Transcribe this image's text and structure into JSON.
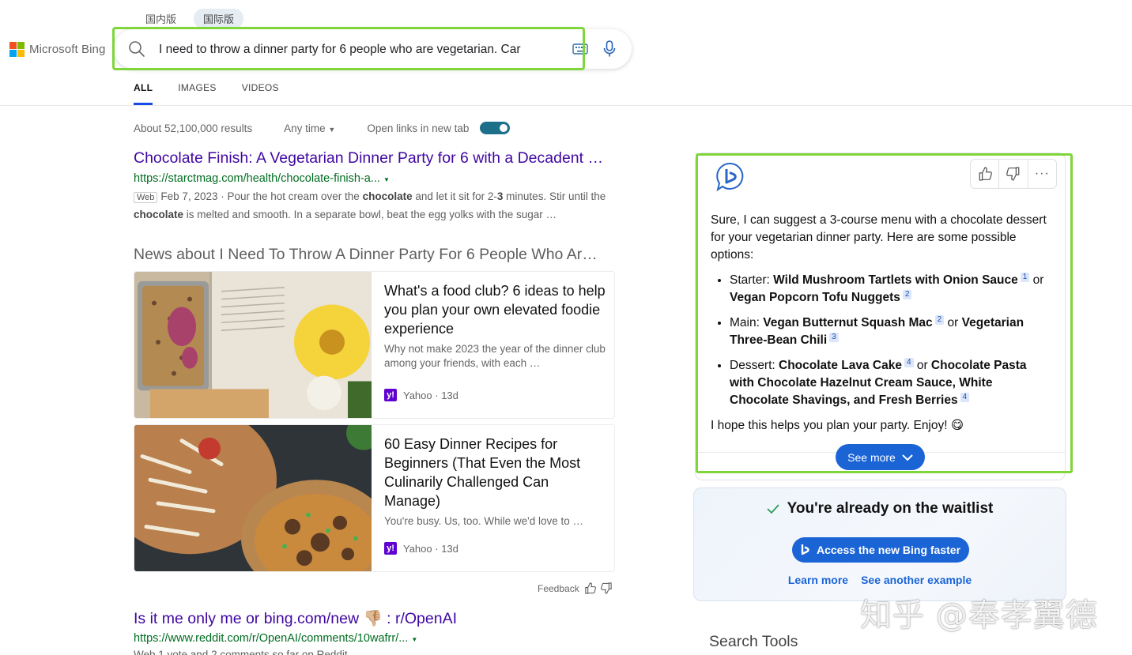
{
  "region_tabs": [
    {
      "label": "国内版",
      "active": false
    },
    {
      "label": "国际版",
      "active": true
    }
  ],
  "logo": {
    "text": "Microsoft Bing"
  },
  "search": {
    "value": "I need to throw a dinner party for 6 people who are vegetarian. Car",
    "keyboard_icon": "keyboard-icon",
    "mic_icon": "microphone-icon"
  },
  "nav_tabs": [
    {
      "label": "ALL",
      "active": true
    },
    {
      "label": "IMAGES",
      "active": false
    },
    {
      "label": "VIDEOS",
      "active": false
    }
  ],
  "results_info": {
    "count": "About 52,100,000 results",
    "time_filter": "Any time",
    "new_tab_label": "Open links in new tab",
    "new_tab_on": true
  },
  "result1": {
    "title": "Chocolate Finish: A Vegetarian Dinner Party for 6 with a Decadent …",
    "url": "https://starctmag.com/health/chocolate-finish-a...",
    "tag": "Web",
    "snippet_parts": [
      "Feb 7, 2023 · Pour the hot cream over the ",
      "chocolate",
      " and let it sit for 2-",
      "3",
      " minutes. Stir until the ",
      "chocolate",
      " is melted and smooth. In a separate bowl, beat the egg yolks with the sugar …"
    ]
  },
  "news": {
    "header": "News about I Need To Throw A Dinner Party For 6 People Who Ar…",
    "items": [
      {
        "title": "What's a food club? 6 ideas to help you plan your own elevated foodie experience",
        "desc": "Why not make 2023 the year of the dinner club among your friends, with each …",
        "source": "Yahoo",
        "age": "· 13d"
      },
      {
        "title": "60 Easy Dinner Recipes for Beginners (That Even the Most Culinarily Challenged Can Manage)",
        "desc": "You're busy. Us, too. While we'd love to …",
        "source": "Yahoo",
        "age": "· 13d"
      }
    ]
  },
  "feedback": {
    "label": "Feedback"
  },
  "result2": {
    "title": "Is it me only me or bing.com/new 👎🏼 : r/OpenAI",
    "url": "https://www.reddit.com/r/OpenAI/comments/10wafrr/...",
    "snippet": "Web 1 vote and 2 comments so far on Reddit"
  },
  "chat": {
    "intro": "Sure, I can suggest a 3-course menu with a chocolate dessert for your vegetarian dinner party. Here are some possible options:",
    "starter": {
      "label": "Starter: ",
      "opt1": "Wild Mushroom Tartlets with Onion Sauce",
      "cite1": "1",
      "or": " or ",
      "opt2": "Vegan Popcorn Tofu Nuggets",
      "cite2": "2"
    },
    "main": {
      "label": "Main: ",
      "opt1": "Vegan Butternut Squash Mac",
      "cite1": "2",
      "or": " or ",
      "opt2": "Vegetarian Three-Bean Chili",
      "cite2": "3"
    },
    "dessert": {
      "label": "Dessert: ",
      "opt1": "Chocolate Lava Cake",
      "cite1": "4",
      "or": " or ",
      "opt2": "Chocolate Pasta with Chocolate Hazelnut Cream Sauce, White Chocolate Shavings, and Fresh Berries",
      "cite2": "4"
    },
    "closing": "I hope this helps you plan your party. Enjoy! 😋",
    "see_more": "See more"
  },
  "waitlist": {
    "title": "You're already on the waitlist",
    "button": "Access the new Bing faster",
    "link1": "Learn more",
    "link2": "See another example"
  },
  "search_tools": "Search Tools",
  "watermark": "知乎 @奉孝翼德",
  "colors": {
    "accent": "#1a64d6",
    "link": "#4007a2",
    "url": "#006d21",
    "highlight": "#7ed63a"
  }
}
